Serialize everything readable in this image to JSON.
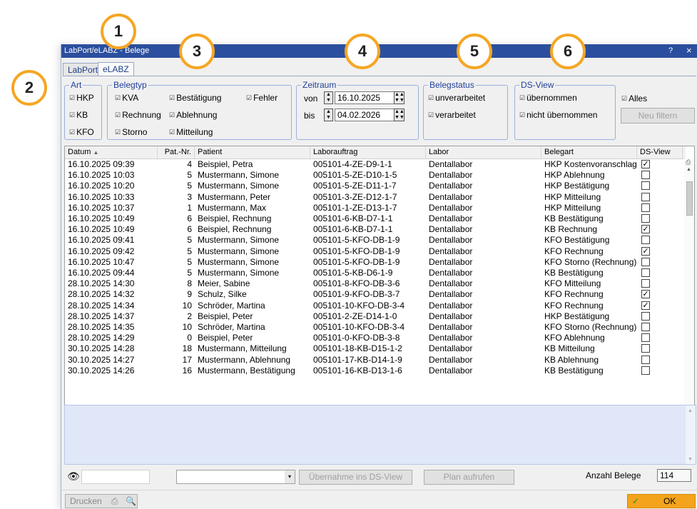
{
  "window": {
    "title": "LabPort/eLABZ - Belege",
    "help": "?",
    "close": "×"
  },
  "tabs": [
    {
      "label": "LabPort"
    },
    {
      "label": "eLABZ"
    }
  ],
  "markers": [
    "1",
    "2",
    "3",
    "4",
    "5",
    "6"
  ],
  "art": {
    "legend": "Art",
    "items": [
      "HKP",
      "KB",
      "KFO"
    ]
  },
  "belegtyp": {
    "legend": "Belegtyp",
    "items": [
      "KVA",
      "Rechnung",
      "Storno",
      "Bestätigung",
      "Ablehnung",
      "Mitteilung",
      "Fehler"
    ]
  },
  "zeitraum": {
    "legend": "Zeitraum",
    "von_label": "von",
    "bis_label": "bis",
    "von": "16.10.2025",
    "bis": "04.02.2026"
  },
  "belegstatus": {
    "legend": "Belegstatus",
    "items": [
      "unverarbeitet",
      "verarbeitet"
    ]
  },
  "dsview": {
    "legend": "DS-View",
    "items": [
      "übernommen",
      "nicht übernommen"
    ]
  },
  "alles_label": "Alles",
  "neu_filtern": "Neu filtern",
  "columns": [
    "Datum",
    "Pat.-Nr.",
    "Patient",
    "Laborauftrag",
    "Labor",
    "Belegart",
    "DS-View"
  ],
  "rows": [
    [
      "16.10.2025 09:39",
      "4",
      "Beispiel, Petra",
      "005101-4-ZE-D9-1-1",
      "Dentallabor",
      "HKP Kostenvoranschlag",
      true
    ],
    [
      "16.10.2025 10:03",
      "5",
      "Mustermann, Simone",
      "005101-5-ZE-D10-1-5",
      "Dentallabor",
      "HKP Ablehnung",
      false
    ],
    [
      "16.10.2025 10:20",
      "5",
      "Mustermann, Simone",
      "005101-5-ZE-D11-1-7",
      "Dentallabor",
      "HKP Bestätigung",
      false
    ],
    [
      "16.10.2025 10:33",
      "3",
      "Mustermann, Peter",
      "005101-3-ZE-D12-1-7",
      "Dentallabor",
      "HKP Mitteilung",
      false
    ],
    [
      "16.10.2025 10:37",
      "1",
      "Mustermann, Max",
      "005101-1-ZE-D13-1-7",
      "Dentallabor",
      "HKP Mitteilung",
      false
    ],
    [
      "16.10.2025 10:49",
      "6",
      "Beispiel, Rechnung",
      "005101-6-KB-D7-1-1",
      "Dentallabor",
      "KB Bestätigung",
      false
    ],
    [
      "16.10.2025 10:49",
      "6",
      "Beispiel, Rechnung",
      "005101-6-KB-D7-1-1",
      "Dentallabor",
      "KB Rechnung",
      true
    ],
    [
      "16.10.2025 09:41",
      "5",
      "Mustermann, Simone",
      "005101-5-KFO-DB-1-9",
      "Dentallabor",
      "KFO Bestätigung",
      false
    ],
    [
      "16.10.2025 09:42",
      "5",
      "Mustermann, Simone",
      "005101-5-KFO-DB-1-9",
      "Dentallabor",
      "KFO Rechnung",
      true
    ],
    [
      "16.10.2025 10:47",
      "5",
      "Mustermann, Simone",
      "005101-5-KFO-DB-1-9",
      "Dentallabor",
      "KFO Storno (Rechnung)",
      false
    ],
    [
      "16.10.2025 09:44",
      "5",
      "Mustermann, Simone",
      "005101-5-KB-D6-1-9",
      "Dentallabor",
      "KB Bestätigung",
      false
    ],
    [
      "28.10.2025 14:30",
      "8",
      "Meier, Sabine",
      "005101-8-KFO-DB-3-6",
      "Dentallabor",
      "KFO Mitteilung",
      false
    ],
    [
      "28.10.2025 14:32",
      "9",
      "Schulz, Silke",
      "005101-9-KFO-DB-3-7",
      "Dentallabor",
      "KFO Rechnung",
      true
    ],
    [
      "28.10.2025 14:34",
      "10",
      "Schröder, Martina",
      "005101-10-KFO-DB-3-4",
      "Dentallabor",
      "KFO Rechnung",
      true
    ],
    [
      "28.10.2025 14:37",
      "2",
      "Beispiel, Peter",
      "005101-2-ZE-D14-1-0",
      "Dentallabor",
      "HKP Bestätigung",
      false
    ],
    [
      "28.10.2025 14:35",
      "10",
      "Schröder, Martina",
      "005101-10-KFO-DB-3-4",
      "Dentallabor",
      "KFO Storno (Rechnung)",
      false
    ],
    [
      "28.10.2025 14:29",
      "0",
      "Beispiel, Peter",
      "005101-0-KFO-DB-3-8",
      "Dentallabor",
      "KFO Ablehnung",
      false
    ],
    [
      "30.10.2025 14:28",
      "18",
      "Mustermann, Mitteilung",
      "005101-18-KB-D15-1-2",
      "Dentallabor",
      "KB Mitteilung",
      false
    ],
    [
      "30.10.2025 14:27",
      "17",
      "Mustermann, Ablehnung",
      "005101-17-KB-D14-1-9",
      "Dentallabor",
      "KB Ablehnung",
      false
    ],
    [
      "30.10.2025 14:26",
      "16",
      "Mustermann, Bestätigung",
      "005101-16-KB-D13-1-6",
      "Dentallabor",
      "KB Bestätigung",
      false
    ]
  ],
  "bottom": {
    "uebernahme": "Übernahme ins DS-View",
    "plan": "Plan aufrufen",
    "anzahl_label": "Anzahl Belege",
    "anzahl": "114",
    "drucken": "Drucken",
    "ok": "OK"
  }
}
